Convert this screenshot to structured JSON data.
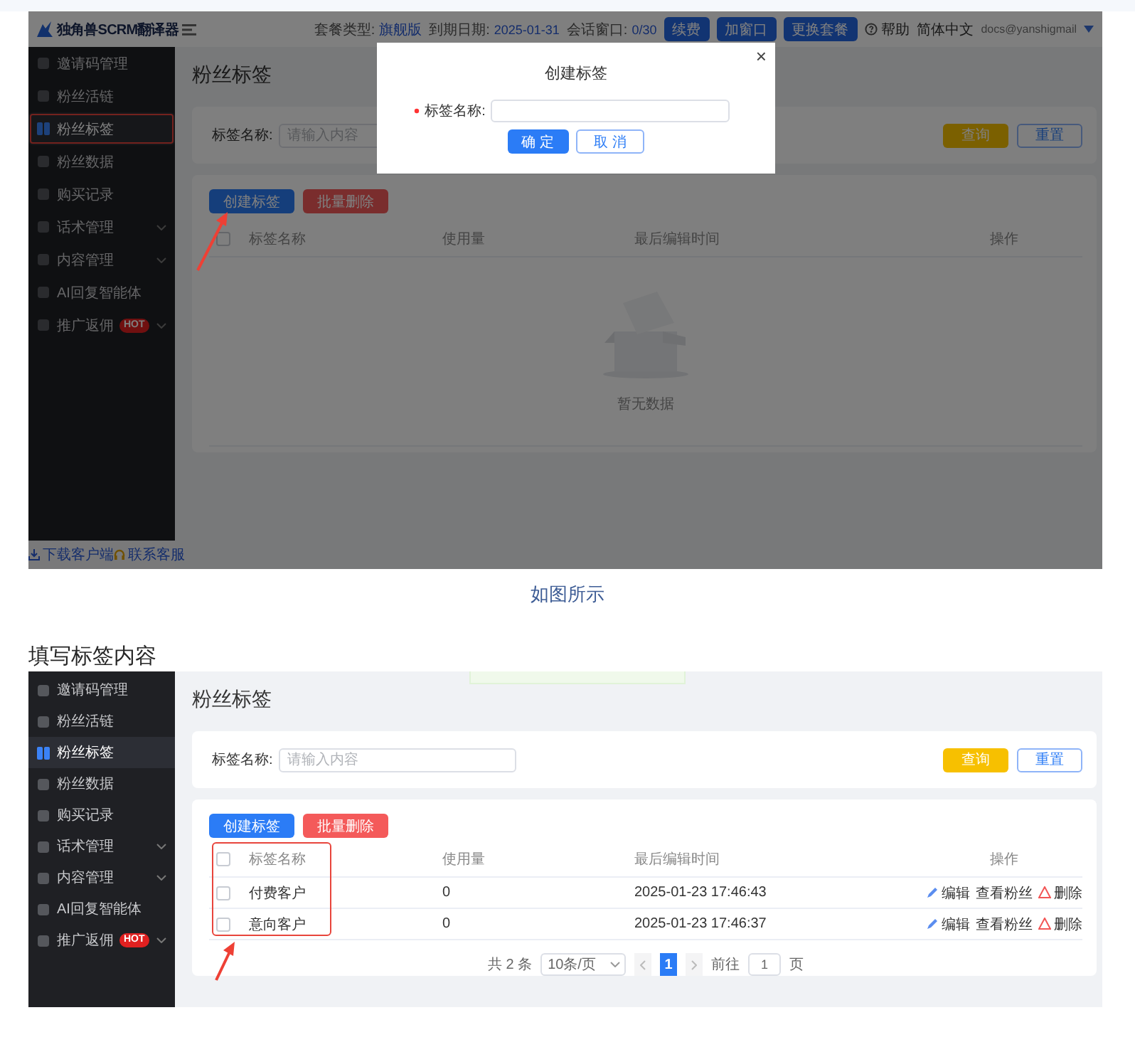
{
  "screenshot_1": {
    "header": {
      "logo": "独角兽SCRM翻译器",
      "info": [
        {
          "label": "套餐类型:",
          "value": "旗舰版"
        },
        {
          "label": "到期日期:",
          "value": "2025-01-31"
        },
        {
          "label": "会话窗口:",
          "value": "0/30"
        }
      ],
      "buttons": [
        "续费",
        "加窗口",
        "更换套餐"
      ],
      "help": "帮助",
      "language": "简体中文",
      "user": "docs@yanshigmail"
    },
    "sidebar": {
      "items": [
        {
          "label": "邀请码管理",
          "selected": false,
          "expandable": false
        },
        {
          "label": "粉丝活链",
          "selected": false,
          "expandable": false
        },
        {
          "label": "粉丝标签",
          "selected": true,
          "expandable": false,
          "highlighted": true
        },
        {
          "label": "粉丝数据",
          "selected": false,
          "expandable": false
        },
        {
          "label": "购买记录",
          "selected": false,
          "expandable": false
        },
        {
          "label": "话术管理",
          "selected": false,
          "expandable": true
        },
        {
          "label": "内容管理",
          "selected": false,
          "expandable": true
        },
        {
          "label": "AI回复智能体",
          "selected": false,
          "expandable": false
        },
        {
          "label": "推广返佣",
          "selected": false,
          "expandable": true,
          "badge": "HOT"
        }
      ],
      "footer_links": [
        "下载客户端",
        "联系客服"
      ]
    },
    "page_title": "粉丝标签",
    "filter": {
      "label": "标签名称:",
      "placeholder": "请输入内容",
      "buttons": [
        {
          "label": "查询",
          "kind": "warning"
        },
        {
          "label": "重置",
          "kind": "plain"
        }
      ]
    },
    "toolbar": [
      {
        "label": "创建标签",
        "kind": "primary"
      },
      {
        "label": "批量删除",
        "kind": "danger"
      }
    ],
    "table": {
      "select_all_checked": false,
      "columns": [
        "标签名称",
        "使用量",
        "最后编辑时间",
        "操作"
      ],
      "empty_text": "暂无数据"
    },
    "dialog": {
      "title": "创建标签",
      "close": "×",
      "field_label": "标签名称:",
      "required": true,
      "buttons": [
        {
          "label": "确 定",
          "kind": "primary"
        },
        {
          "label": "取 消",
          "kind": "plain"
        }
      ]
    },
    "annotations": [
      {
        "kind": "arrow"
      }
    ]
  },
  "caption": "如图所示",
  "section_heading": "填写标签内容",
  "screenshot_2": {
    "toast": {
      "kind": "success"
    },
    "sidebar": {
      "items": [
        {
          "label": "邀请码管理",
          "selected": false,
          "expandable": false
        },
        {
          "label": "粉丝活链",
          "selected": false,
          "expandable": false
        },
        {
          "label": "粉丝标签",
          "selected": true,
          "expandable": false
        },
        {
          "label": "粉丝数据",
          "selected": false,
          "expandable": false
        },
        {
          "label": "购买记录",
          "selected": false,
          "expandable": false
        },
        {
          "label": "话术管理",
          "selected": false,
          "expandable": true
        },
        {
          "label": "内容管理",
          "selected": false,
          "expandable": true
        },
        {
          "label": "AI回复智能体",
          "selected": false,
          "expandable": false
        },
        {
          "label": "推广返佣",
          "selected": false,
          "expandable": true,
          "badge": "HOT"
        }
      ]
    },
    "page_title": "粉丝标签",
    "filter": {
      "label": "标签名称:",
      "placeholder": "请输入内容",
      "buttons": [
        {
          "label": "查询",
          "kind": "warning"
        },
        {
          "label": "重置",
          "kind": "plain"
        }
      ]
    },
    "toolbar": [
      {
        "label": "创建标签",
        "kind": "primary"
      },
      {
        "label": "批量删除",
        "kind": "danger"
      }
    ],
    "table": {
      "select_all_checked": false,
      "columns": [
        "标签名称",
        "使用量",
        "最后编辑时间",
        "操作"
      ],
      "rows": [
        {
          "checked": false,
          "cells": [
            "付费客户",
            "0",
            "2025-01-23 17:46:43"
          ],
          "actions": [
            {
              "label": "编辑",
              "kind": "edit"
            },
            {
              "label": "查看粉丝",
              "kind": "view"
            },
            {
              "label": "删除",
              "kind": "delete"
            }
          ]
        },
        {
          "checked": false,
          "cells": [
            "意向客户",
            "0",
            "2025-01-23 17:46:37"
          ],
          "actions": [
            {
              "label": "编辑",
              "kind": "edit"
            },
            {
              "label": "查看粉丝",
              "kind": "view"
            },
            {
              "label": "删除",
              "kind": "delete"
            }
          ]
        }
      ]
    },
    "pagination": {
      "total": "共 2 条",
      "page_size": "10条/页",
      "pages": [
        {
          "label": "1",
          "selected": true
        }
      ],
      "jump_label": "前往",
      "jump_value": "1",
      "jump_suffix": "页"
    },
    "annotations": [
      {
        "kind": "frame"
      },
      {
        "kind": "arrow"
      }
    ]
  }
}
